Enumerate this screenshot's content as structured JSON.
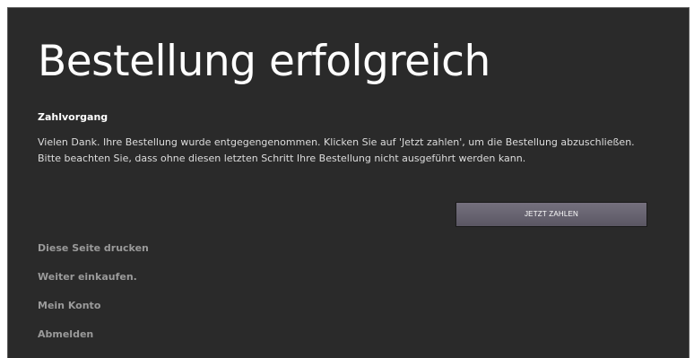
{
  "page": {
    "title": "Bestellung erfolgreich",
    "section_heading": "Zahlvorgang",
    "message": "Vielen Dank. Ihre Bestellung wurde entgegengenommen. Klicken Sie auf 'Jetzt zahlen', um die Bestellung abzuschließen. Bitte beachten Sie, dass ohne diesen letzten Schritt Ihre Bestellung nicht ausgeführt werden kann.",
    "pay_button_label": "JETZT ZAHLEN"
  },
  "links": [
    {
      "label": "Diese Seite drucken"
    },
    {
      "label": "Weiter einkaufen."
    },
    {
      "label": "Mein Konto"
    },
    {
      "label": "Abmelden"
    }
  ],
  "colors": {
    "background": "#2a2a2a",
    "button": "#6a6573",
    "link": "#9a9a9a"
  }
}
